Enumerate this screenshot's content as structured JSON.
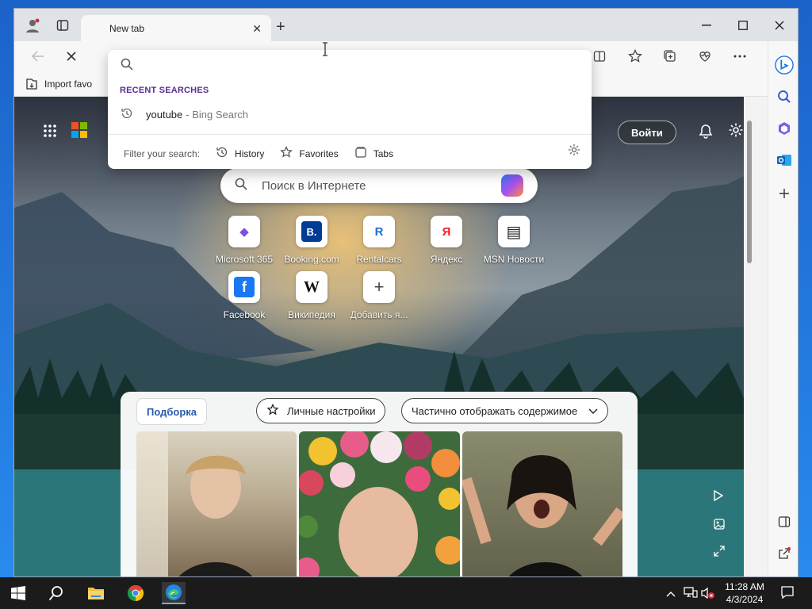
{
  "browser": {
    "tab_title": "New tab",
    "new_tab_symbol": "+",
    "tab_close_symbol": "✕",
    "favorites_bar": {
      "import_label": "Import favo"
    }
  },
  "omnibox": {
    "recent_label": "RECENT SEARCHES",
    "recent_item": {
      "query": "youtube",
      "source": "- Bing Search"
    },
    "filter_label": "Filter your search:",
    "filters": [
      "History",
      "Favorites",
      "Tabs"
    ]
  },
  "newtab_page": {
    "signin_label": "Войти",
    "search_placeholder": "Поиск в Интернете",
    "quick_links": [
      {
        "label": "Microsoft 365",
        "glyph": "◆",
        "color": "#7b4fe0"
      },
      {
        "label": "Booking.com",
        "glyph": "B.",
        "color": "#ffffff",
        "bg": "#003b95"
      },
      {
        "label": "Rentalcars",
        "glyph": "R",
        "color": "#1a6fd0"
      },
      {
        "label": "Яндекс",
        "glyph": "Я",
        "color": "#e22"
      },
      {
        "label": "MSN Новости",
        "glyph": "▤",
        "color": "#222"
      },
      {
        "label": "Facebook",
        "glyph": "f",
        "color": "#ffffff",
        "bg": "#1877f2"
      },
      {
        "label": "Википедия",
        "glyph": "W",
        "color": "#111"
      },
      {
        "label": "Добавить я...",
        "glyph": "+",
        "color": "#444"
      }
    ],
    "feed": {
      "tab_label": "Подборка",
      "personalize_label": "Личные настройки",
      "content_mode_label": "Частично отображать содержимое"
    }
  },
  "taskbar": {
    "time": "11:28 AM",
    "date": "4/3/2024"
  },
  "colors": {
    "accent_purple": "#5b2c92",
    "feed_tab_blue": "#2a5ab0",
    "taskbar": "#1b1b1b"
  }
}
